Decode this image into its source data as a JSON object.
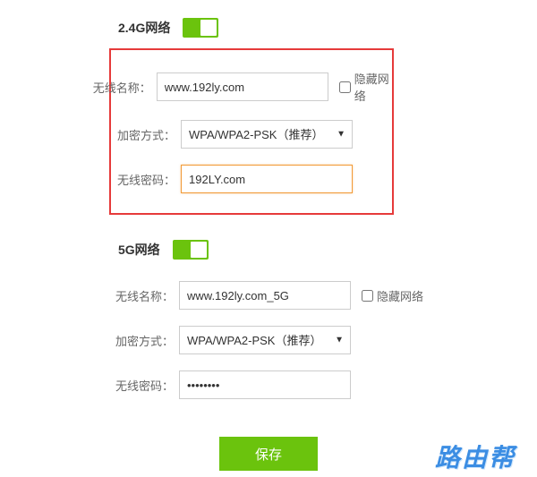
{
  "section24": {
    "title": "2.4G网络",
    "toggle_on": true,
    "ssid_label": "无线名称：",
    "ssid_value": "www.192ly.com",
    "hide_label": "隐藏网络",
    "hide_checked": false,
    "encrypt_label": "加密方式：",
    "encrypt_value": "WPA/WPA2-PSK（推荐）",
    "password_label": "无线密码：",
    "password_value": "192LY.com"
  },
  "section5g": {
    "title": "5G网络",
    "toggle_on": true,
    "ssid_label": "无线名称：",
    "ssid_value": "www.192ly.com_5G",
    "hide_label": "隐藏网络",
    "hide_checked": false,
    "encrypt_label": "加密方式：",
    "encrypt_value": "WPA/WPA2-PSK（推荐）",
    "password_label": "无线密码：",
    "password_value": "••••••••"
  },
  "footer": {
    "save_label": "保存",
    "watermark": "路由帮"
  }
}
